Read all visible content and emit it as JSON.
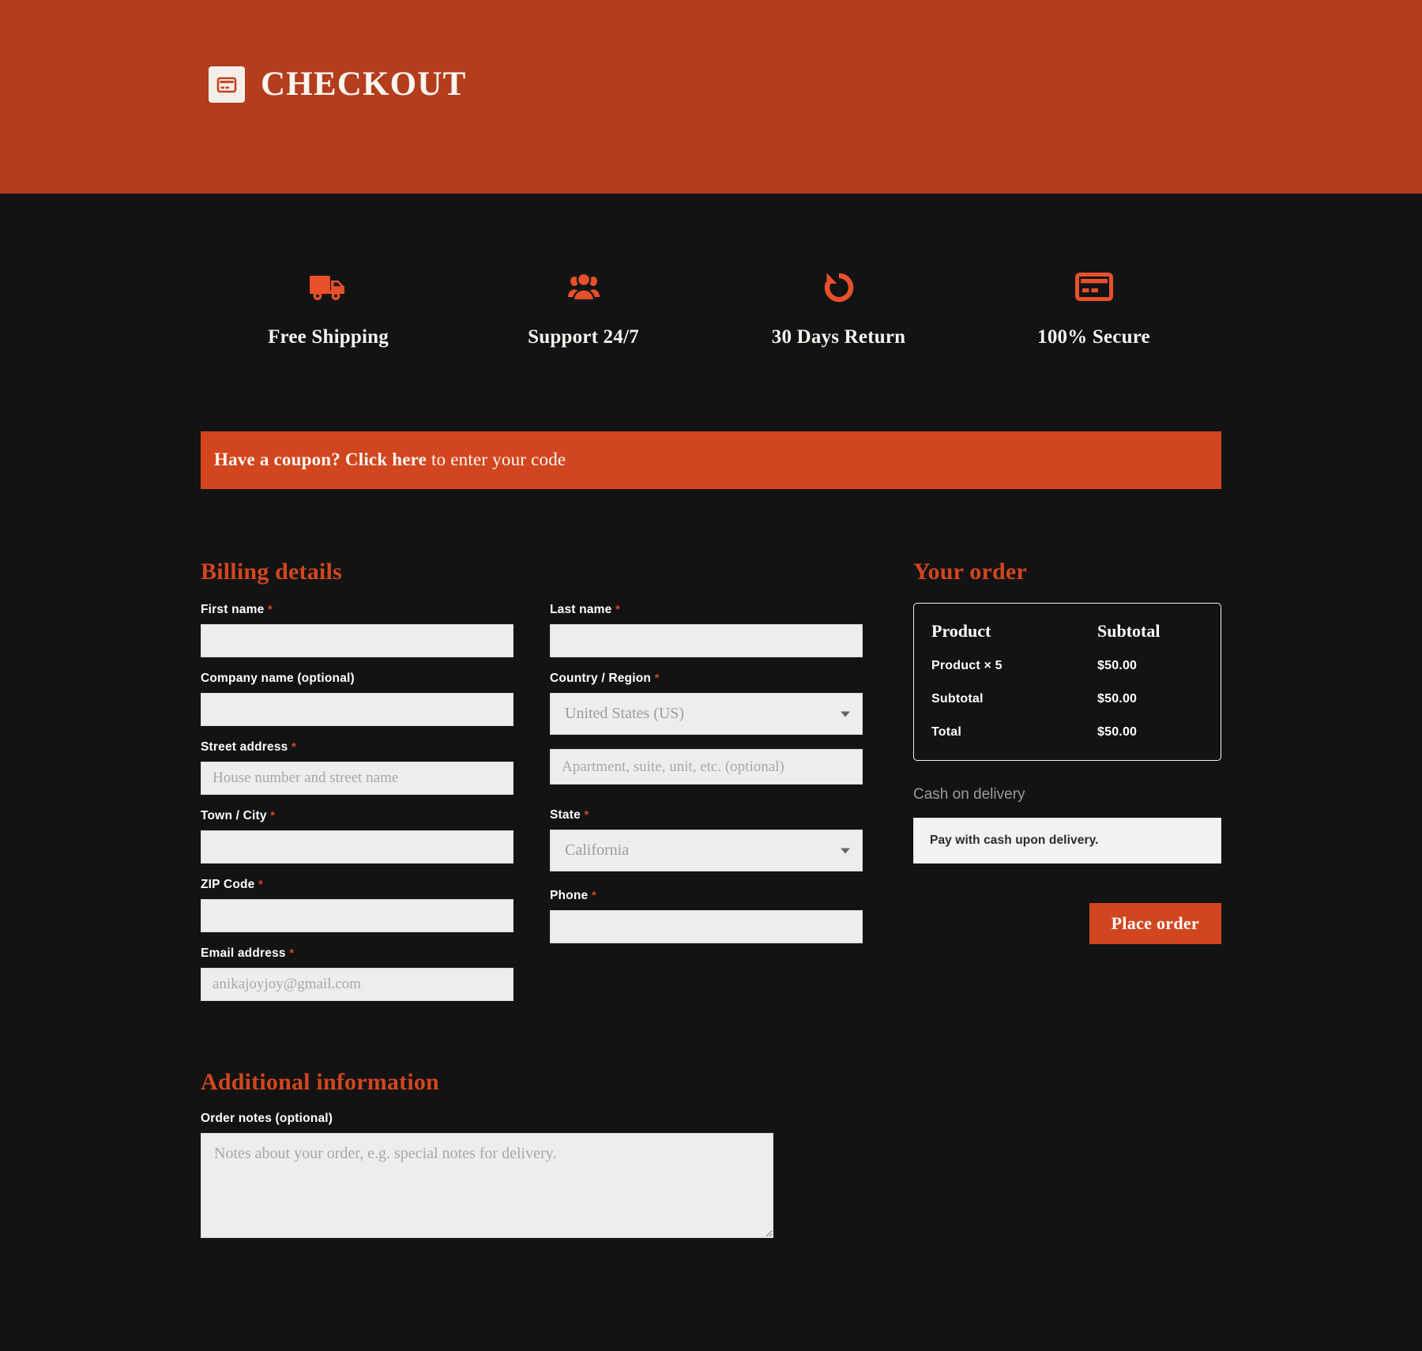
{
  "header": {
    "logo_icon": "credit-card-icon",
    "title": "CHECKOUT",
    "bg_color": "#b33d1d"
  },
  "features": [
    {
      "icon": "truck-icon",
      "label": "Free Shipping"
    },
    {
      "icon": "users-group-icon",
      "label": "Support 24/7"
    },
    {
      "icon": "rotate-left-icon",
      "label": "30 Days Return"
    },
    {
      "icon": "credit-card-icon",
      "label": "100% Secure"
    }
  ],
  "coupon": {
    "bold_text": "Have a coupon? Click here",
    "regular_text": " to enter your code"
  },
  "billing": {
    "title": "Billing details",
    "first_name": {
      "label": "First name",
      "required": "*",
      "value": "",
      "placeholder": ""
    },
    "last_name": {
      "label": "Last name",
      "required": "*",
      "value": "",
      "placeholder": ""
    },
    "company": {
      "label": "Company name (optional)",
      "value": "",
      "placeholder": ""
    },
    "country": {
      "label": "Country / Region",
      "required": "*",
      "value": "United States (US)"
    },
    "street": {
      "label": "Street address",
      "required": "*",
      "value": "",
      "placeholder": "House number and street name"
    },
    "apartment": {
      "value": "",
      "placeholder": "Apartment, suite, unit, etc. (optional)"
    },
    "city": {
      "label": "Town / City",
      "required": "*",
      "value": "",
      "placeholder": ""
    },
    "state": {
      "label": "State",
      "required": "*",
      "value": "California"
    },
    "zip": {
      "label": "ZIP Code",
      "required": "*",
      "value": "",
      "placeholder": ""
    },
    "phone": {
      "label": "Phone",
      "required": "*",
      "value": "",
      "placeholder": ""
    },
    "email": {
      "label": "Email address",
      "required": "*",
      "value": "",
      "placeholder": "anikajoyjoy@gmail.com"
    }
  },
  "additional": {
    "title": "Additional information",
    "notes_label": "Order notes (optional)",
    "notes_value": "",
    "notes_placeholder": "Notes about your order, e.g. special notes for delivery."
  },
  "order": {
    "title": "Your order",
    "headers": {
      "product": "Product",
      "subtotal": "Subtotal"
    },
    "rows": [
      {
        "name": "Product  × 5",
        "amount": "$50.00"
      },
      {
        "name": "Subtotal",
        "amount": "$50.00"
      },
      {
        "name": "Total",
        "amount": "$50.00"
      }
    ],
    "payment_method": "Cash on delivery",
    "payment_description": "Pay with cash upon delivery.",
    "place_order_label": "Place order"
  },
  "colors": {
    "header_bg": "#b33d1d",
    "accent": "#d2461f",
    "page_bg": "#131313",
    "input_bg": "#ededed"
  }
}
